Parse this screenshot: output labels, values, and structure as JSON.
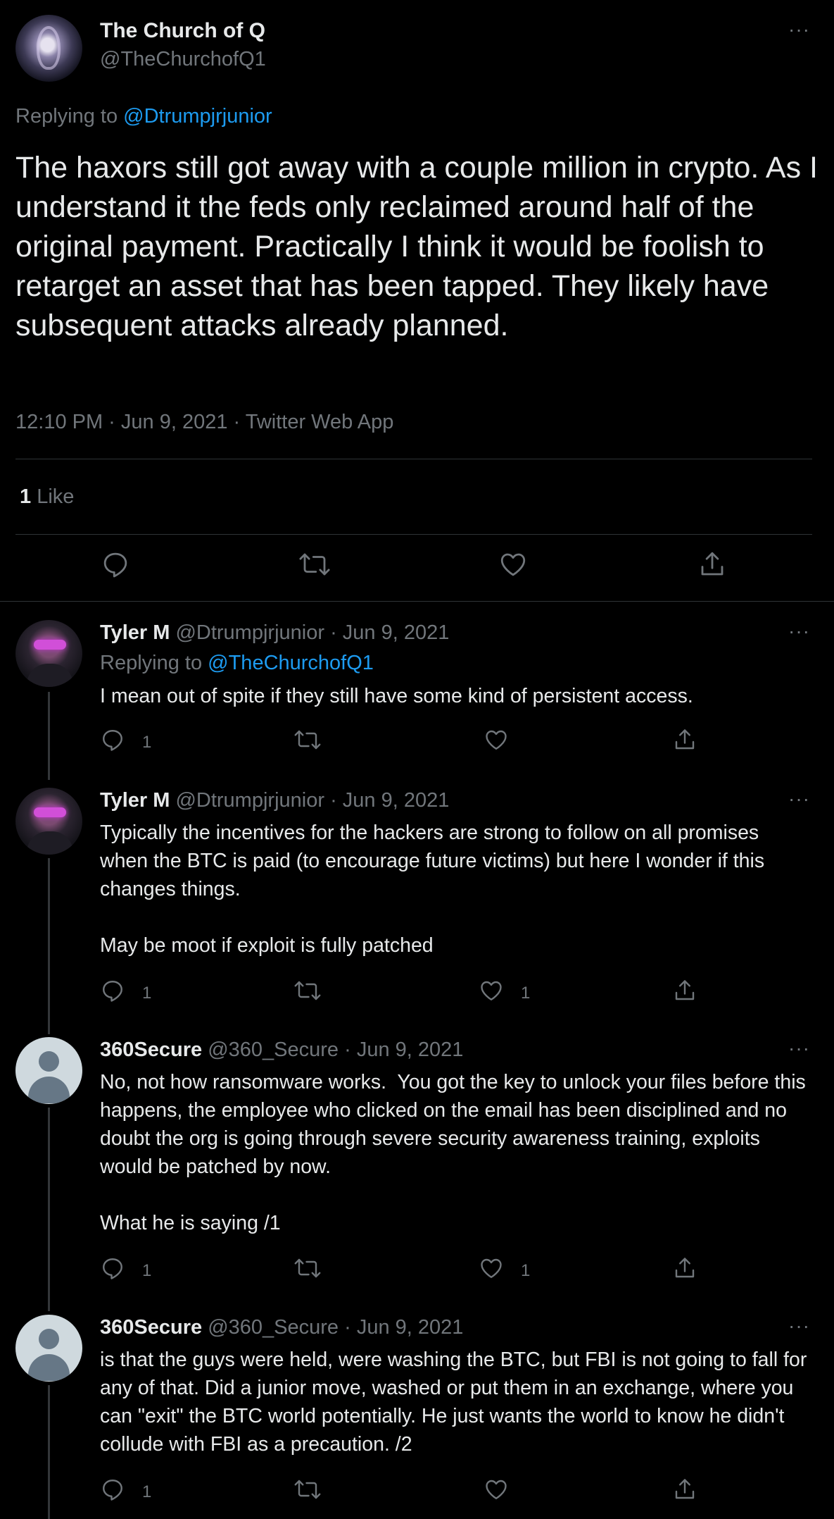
{
  "main_tweet": {
    "name": "The Church of Q",
    "handle": "@TheChurchofQ1",
    "more": "···",
    "replying_prefix": "Replying to",
    "replying_to": "@Dtrumpjrjunior",
    "text": "The haxors still got away with a couple million in crypto. As I understand it the feds only reclaimed around half of the original payment. Practically I think it would be foolish to retarget an asset that has been tapped. They likely have subsequent attacks already planned.",
    "meta": "12:10 PM · Jun 9, 2021 · Twitter Web App",
    "likes_count": "1",
    "likes_label": "Like",
    "icons": [
      "reply-icon",
      "retweet-icon",
      "like-icon",
      "share-icon"
    ]
  },
  "replies": [
    {
      "name": "Tyler M",
      "handle": "@Dtrumpjrjunior",
      "dot": "·",
      "date": "Jun 9, 2021",
      "more": "···",
      "replying_prefix": "Replying to",
      "replying_to": "@TheChurchofQ1",
      "text": "I mean out of spite if they still have some kind of persistent access.",
      "reply_count": "1",
      "like_count": ""
    },
    {
      "name": "Tyler M",
      "handle": "@Dtrumpjrjunior",
      "dot": "·",
      "date": "Jun 9, 2021",
      "more": "···",
      "text": "Typically the incentives for the hackers are strong to follow on all promises when the BTC is paid (to encourage future victims) but here I wonder if this changes things.\n\nMay be moot if exploit is fully patched",
      "reply_count": "1",
      "like_count": "1"
    },
    {
      "name": "360Secure",
      "handle": "@360_Secure",
      "dot": "·",
      "date": "Jun 9, 2021",
      "more": "···",
      "text": "No, not how ransomware works.  You got the key to unlock your files before this happens, the employee who clicked on the email has been disciplined and no doubt the org is going through severe security awareness training, exploits would be patched by now.\n\nWhat he is saying /1",
      "reply_count": "1",
      "like_count": "1"
    },
    {
      "name": "360Secure",
      "handle": "@360_Secure",
      "dot": "·",
      "date": "Jun 9, 2021",
      "more": "···",
      "text": "is that the guys were held, were washing the BTC, but FBI is not going to fall for any of that. Did a junior move, washed or put them in an exchange, where you can \"exit\" the BTC world potentially. He just wants the world to know he didn't collude with FBI as a precaution. /2",
      "reply_count": "1",
      "like_count": ""
    }
  ],
  "colors": {
    "background": "#000000",
    "text": "#e7e9ea",
    "secondary": "#71767b",
    "link": "#1d9bf0",
    "divider": "#2f3336"
  }
}
